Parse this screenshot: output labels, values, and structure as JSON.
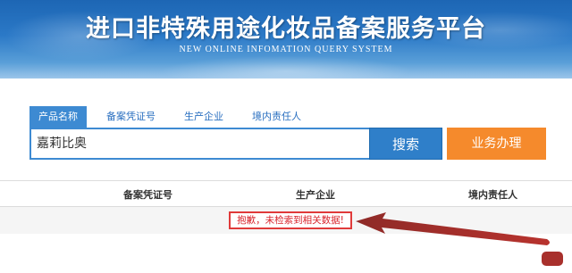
{
  "banner": {
    "title": "进口非特殊用途化妆品备案服务平台",
    "subtitle": "NEW ONLINE INFOMATION QUERY SYSTEM"
  },
  "tabs": [
    {
      "label": "产品名称",
      "active": true
    },
    {
      "label": "备案凭证号",
      "active": false
    },
    {
      "label": "生产企业",
      "active": false
    },
    {
      "label": "境内责任人",
      "active": false
    }
  ],
  "search": {
    "value": "嘉莉比奥",
    "button_label": "搜索"
  },
  "business_button_label": "业务办理",
  "table": {
    "headers": [
      "备案凭证号",
      "生产企业",
      "境内责任人"
    ],
    "empty_message": "抱歉，未检索到相关数据!"
  },
  "colors": {
    "accent": "#3d8ad2",
    "orange": "#f58a2c",
    "alert": "#e03a3a",
    "annotation_arrow": "#a8302c"
  }
}
